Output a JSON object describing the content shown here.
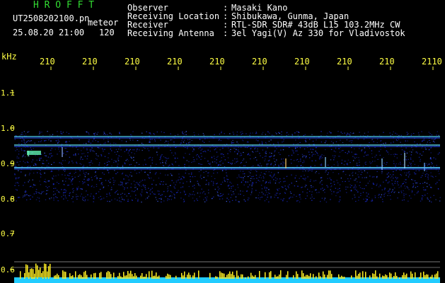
{
  "header": {
    "logo": "H R O F F T",
    "filename": "UT2508202100.pn",
    "mode": "meteor",
    "datetime": "25.08.20 21:00",
    "count": "120",
    "fields": [
      {
        "label": "Observer",
        "sep": ":",
        "value": "Masaki Kano"
      },
      {
        "label": "Receiving Location",
        "sep": ":",
        "value": "Shibukawa, Gunma, Japan"
      },
      {
        "label": "Receiver",
        "sep": ":",
        "value": "RTL-SDR SDR# 43dB L15 103.2MHz CW"
      },
      {
        "label": "Receiving Antenna",
        "sep": ":",
        "value": "3el Yagi(V) Az 330 for Vladivostok"
      }
    ]
  },
  "axes": {
    "y_unit": "kHz",
    "y_ticks": [
      "1.1",
      "1.0",
      "0.9",
      "0.8",
      "0.7",
      "0.6"
    ],
    "x_ticks": [
      "210",
      "210",
      "210",
      "210",
      "210",
      "210",
      "210",
      "210",
      "210",
      "2110"
    ]
  },
  "colors": {
    "logo": "#33dd33",
    "label_text": "#ffffff",
    "ticks": "#ffff44",
    "background": "#000000",
    "spectrum": "#2244ff",
    "footer": "#22ccff"
  }
}
